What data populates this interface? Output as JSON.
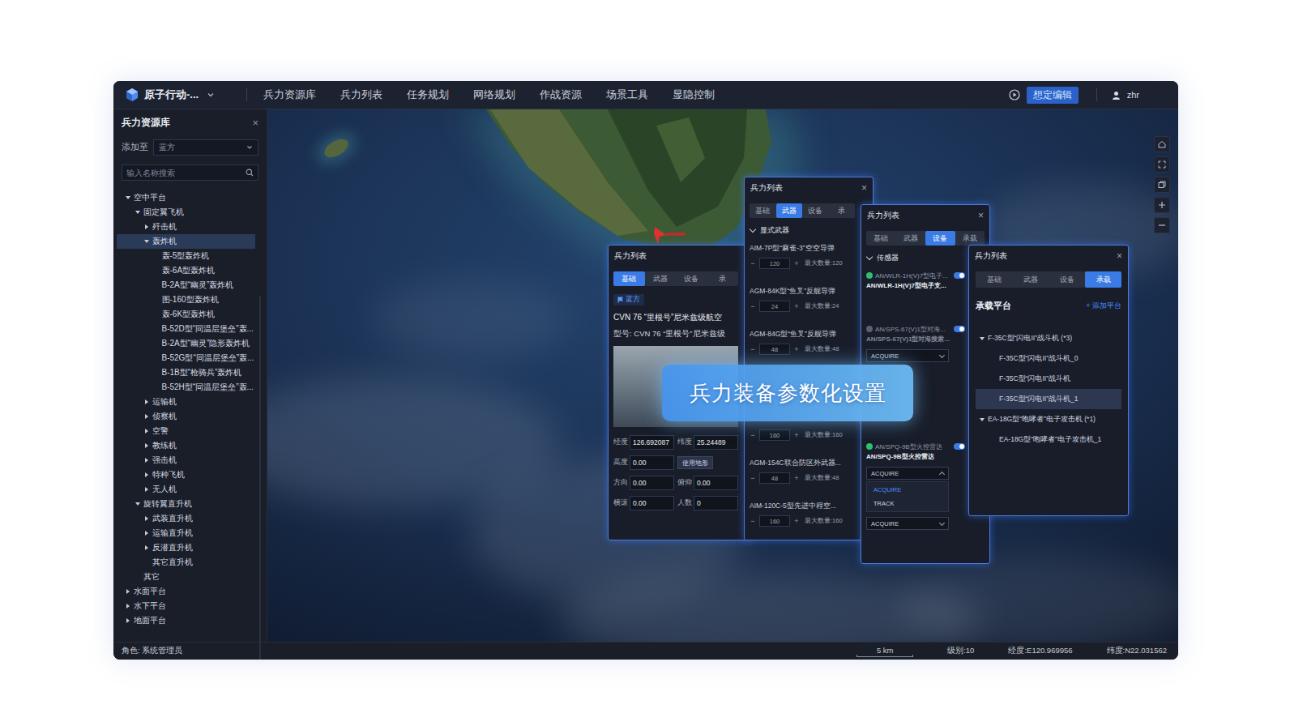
{
  "header": {
    "app_title": "原子行动-...",
    "menu": [
      {
        "label": "兵力资源库"
      },
      {
        "label": "兵力列表"
      },
      {
        "label": "任务规划"
      },
      {
        "label": "网络规划"
      },
      {
        "label": "作战资源"
      },
      {
        "label": "场景工具"
      },
      {
        "label": "显隐控制"
      }
    ],
    "mode_button": "想定编辑",
    "user": "zhr"
  },
  "sidebar": {
    "title": "兵力资源库",
    "close": "×",
    "add_to_label": "添加至",
    "add_to_value": "蓝方",
    "search_placeholder": "输入名称搜索",
    "tree": [
      {
        "label": "空中平台",
        "level": 0,
        "expandable": true,
        "expanded": true,
        "selected": false
      },
      {
        "label": "固定翼飞机",
        "level": 1,
        "expandable": true,
        "expanded": true,
        "selected": false
      },
      {
        "label": "歼击机",
        "level": 2,
        "expandable": true,
        "expanded": false,
        "selected": false
      },
      {
        "label": "轰炸机",
        "level": 2,
        "expandable": true,
        "expanded": true,
        "selected": true
      },
      {
        "label": "轰-5型轰炸机",
        "level": 3,
        "expandable": false,
        "expanded": false,
        "selected": false
      },
      {
        "label": "轰-6A型轰炸机",
        "level": 3,
        "expandable": false,
        "expanded": false,
        "selected": false
      },
      {
        "label": "B-2A型“幽灵”轰炸机",
        "level": 3,
        "expandable": false,
        "expanded": false,
        "selected": false
      },
      {
        "label": "图-160型轰炸机",
        "level": 3,
        "expandable": false,
        "expanded": false,
        "selected": false
      },
      {
        "label": "轰-6K型轰炸机",
        "level": 3,
        "expandable": false,
        "expanded": false,
        "selected": false
      },
      {
        "label": "B-52D型“同温层堡垒”轰...",
        "level": 3,
        "expandable": false,
        "expanded": false,
        "selected": false
      },
      {
        "label": "B-2A型“幽灵”隐形轰炸机",
        "level": 3,
        "expandable": false,
        "expanded": false,
        "selected": false
      },
      {
        "label": "B-52G型“同温层堡垒”轰...",
        "level": 3,
        "expandable": false,
        "expanded": false,
        "selected": false
      },
      {
        "label": "B-1B型“枪骑兵”轰炸机",
        "level": 3,
        "expandable": false,
        "expanded": false,
        "selected": false
      },
      {
        "label": "B-52H型“同温层堡垒”轰...",
        "level": 3,
        "expandable": false,
        "expanded": false,
        "selected": false
      },
      {
        "label": "运输机",
        "level": 2,
        "expandable": true,
        "expanded": false,
        "selected": false
      },
      {
        "label": "侦察机",
        "level": 2,
        "expandable": true,
        "expanded": false,
        "selected": false
      },
      {
        "label": "空警",
        "level": 2,
        "expandable": true,
        "expanded": false,
        "selected": false
      },
      {
        "label": "教练机",
        "level": 2,
        "expandable": true,
        "expanded": false,
        "selected": false
      },
      {
        "label": "强击机",
        "level": 2,
        "expandable": true,
        "expanded": false,
        "selected": false
      },
      {
        "label": "特种飞机",
        "level": 2,
        "expandable": true,
        "expanded": false,
        "selected": false
      },
      {
        "label": "无人机",
        "level": 2,
        "expandable": true,
        "expanded": false,
        "selected": false
      },
      {
        "label": "旋转翼直升机",
        "level": 1,
        "expandable": true,
        "expanded": true,
        "selected": false
      },
      {
        "label": "武装直升机",
        "level": 2,
        "expandable": true,
        "expanded": false,
        "selected": false
      },
      {
        "label": "运输直升机",
        "level": 2,
        "expandable": true,
        "expanded": false,
        "selected": false
      },
      {
        "label": "反潜直升机",
        "level": 2,
        "expandable": true,
        "expanded": false,
        "selected": false
      },
      {
        "label": "其它直升机",
        "level": 2,
        "expandable": false,
        "expanded": false,
        "selected": false
      },
      {
        "label": "其它",
        "level": 1,
        "expandable": false,
        "expanded": false,
        "selected": false
      },
      {
        "label": "水面平台",
        "level": 0,
        "expandable": true,
        "expanded": false,
        "selected": false
      },
      {
        "label": "水下平台",
        "level": 0,
        "expandable": true,
        "expanded": false,
        "selected": false
      },
      {
        "label": "地面平台",
        "level": 0,
        "expandable": true,
        "expanded": false,
        "selected": false
      }
    ]
  },
  "panel_basic": {
    "title": "兵力列表",
    "tabs": [
      {
        "label": "基础",
        "selected": true
      },
      {
        "label": "武器",
        "selected": false
      },
      {
        "label": "设备",
        "selected": false
      },
      {
        "label": "承",
        "selected": false
      }
    ],
    "side_tag": "蓝方",
    "name": "CVN 76 “里根号”尼米兹级航空",
    "model": "型号: CVN 76 “里根号”尼米兹级",
    "fields": [
      {
        "kind": "input",
        "label": "经度",
        "value": "126.692087"
      },
      {
        "kind": "input",
        "label": "纬度",
        "value": "25.24489"
      },
      {
        "kind": "input",
        "label": "高度",
        "value": "0.00"
      },
      {
        "kind": "button",
        "label": "使用地形"
      },
      {
        "kind": "input",
        "label": "方向",
        "value": "0.00"
      },
      {
        "kind": "input",
        "label": "俯仰",
        "value": "0.00"
      },
      {
        "kind": "input",
        "label": "横滚",
        "value": "0.00"
      },
      {
        "kind": "input",
        "label": "人数",
        "value": "0"
      }
    ]
  },
  "panel_weapons": {
    "title": "兵力列表",
    "close": "×",
    "tabs": [
      {
        "label": "基础",
        "selected": false
      },
      {
        "label": "武器",
        "selected": true
      },
      {
        "label": "设备",
        "selected": false
      },
      {
        "label": "承",
        "selected": false
      }
    ],
    "section": "显式武器",
    "section_expanded": true,
    "stepper_minus": "−",
    "stepper_plus": "+",
    "items": [
      {
        "name": "AIM-7P型“麻雀-3”空空导弹",
        "count": "120",
        "max": "最大数量:120"
      },
      {
        "name": "AGM-84K型“鱼叉”反舰导弹",
        "count": "24",
        "max": "最大数量:24"
      },
      {
        "name": "AGM-84G型“鱼叉”反舰导弹",
        "count": "48",
        "max": "最大数量:48"
      },
      {
        "count": "160",
        "max": "最大数量:160"
      },
      {
        "name": "AGM-154C联合防区外武器...",
        "count": "48",
        "max": "最大数量:48"
      },
      {
        "name": "AIM-120C-5型先进中程空...",
        "count": "160",
        "max": "最大数量:160"
      }
    ]
  },
  "panel_sensors": {
    "title": "兵力列表",
    "close": "×",
    "tabs": [
      {
        "label": "基础",
        "selected": false
      },
      {
        "label": "武器",
        "selected": false
      },
      {
        "label": "设备",
        "selected": true
      },
      {
        "label": "承载",
        "selected": false
      }
    ],
    "section": "传感器",
    "section_expanded": true,
    "sensors": [
      {
        "name": "AN/WLR-1H(V)7型电子...",
        "detail": "AN/WLR-1H(V)7型电子支...",
        "enabled": true,
        "on": true,
        "selects": []
      },
      {
        "name": "AN/SPS-67(V)1型对海...",
        "detail": "AN/SPS-67(V)1型对海搜索...",
        "enabled": false,
        "on": true,
        "selects": [
          {
            "value": "ACQUIRE",
            "open": false
          }
        ]
      },
      {
        "name": "AN/SPQ-9B型火控雷达",
        "detail": "AN/SPQ-9B型火控雷达",
        "enabled": true,
        "on": true,
        "selects": [
          {
            "value": "ACQUIRE",
            "open": true,
            "options": [
              {
                "label": "ACQUIRE",
                "selected": true
              },
              {
                "label": "TRACK",
                "selected": false
              }
            ]
          },
          {
            "value": "ACQUIRE",
            "open": false
          }
        ]
      }
    ]
  },
  "panel_carrier": {
    "title": "兵力列表",
    "close": "×",
    "tabs": [
      {
        "label": "基础",
        "selected": false
      },
      {
        "label": "武器",
        "selected": false
      },
      {
        "label": "设备",
        "selected": false
      },
      {
        "label": "承载",
        "selected": true
      }
    ],
    "heading": "承载平台",
    "add": "+ 添加平台",
    "tree": [
      {
        "label": "F-35C型“闪电II”战斗机 (*3)",
        "level": 0,
        "expandable": true,
        "expanded": true,
        "selected": false
      },
      {
        "label": "F-35C型“闪电II”战斗机_0",
        "level": 1,
        "expandable": false,
        "expanded": false,
        "selected": false
      },
      {
        "label": "F-35C型“闪电II”战斗机",
        "level": 1,
        "expandable": false,
        "expanded": false,
        "selected": false
      },
      {
        "label": "F-35C型“闪电II”战斗机_1",
        "level": 1,
        "expandable": false,
        "expanded": false,
        "selected": true
      },
      {
        "label": "EA-18G型“咆哮者”电子攻击机 (*1)",
        "level": 0,
        "expandable": true,
        "expanded": true,
        "selected": false
      },
      {
        "label": "EA-18G型“咆哮者”电子攻击机_1",
        "level": 1,
        "expandable": false,
        "expanded": false,
        "selected": false
      }
    ]
  },
  "banner": {
    "text": "兵力装备参数化设置"
  },
  "status_bar": {
    "role": "角色: 系统管理员",
    "scale": "5 km",
    "level": "级别:10",
    "lon": "经度:E120.969956",
    "lat": "纬度:N22.031562"
  }
}
